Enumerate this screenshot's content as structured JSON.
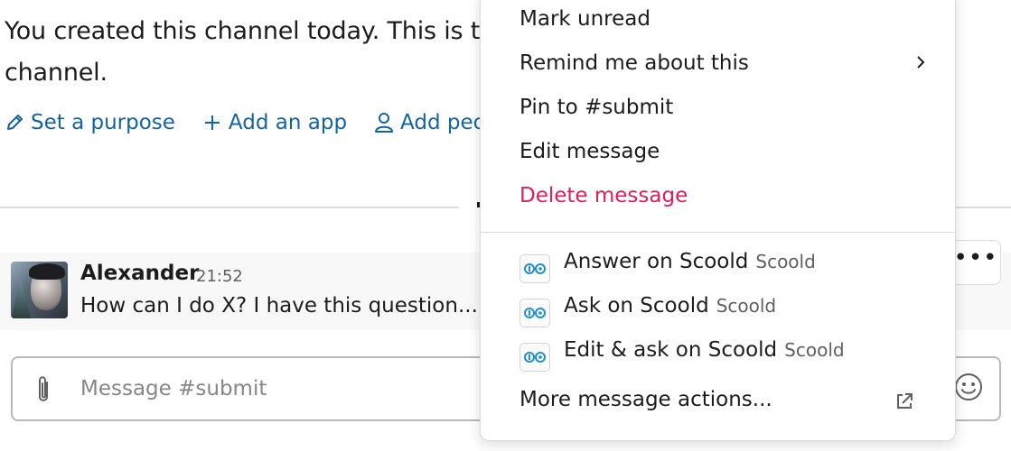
{
  "channel_intro": {
    "text": "You created this channel today. This is t channel.",
    "line1": "You created this channel today. This is t",
    "line2": "channel.",
    "actions": [
      {
        "icon": "pencil-icon",
        "label": "Set a purpose"
      },
      {
        "icon": "plus-icon",
        "label": "Add an app"
      },
      {
        "icon": "person-icon",
        "label": "Add peop"
      }
    ]
  },
  "message": {
    "author": "Alexander",
    "time": "21:52",
    "text": "How can I do X? I have this question..."
  },
  "message_actions": {
    "more_label": "•••"
  },
  "composer": {
    "placeholder": "Message #submit",
    "attach_icon": "paperclip-icon",
    "emoji_icon": "emoji-icon"
  },
  "context_menu": {
    "items": [
      {
        "label": "Mark unread"
      },
      {
        "label": "Remind me about this",
        "has_submenu": true
      },
      {
        "label": "Pin to #submit"
      },
      {
        "label": "Edit message"
      },
      {
        "label": "Delete message",
        "danger": true
      }
    ],
    "app_actions": [
      {
        "label": "Answer on Scoold",
        "app": "Scoold"
      },
      {
        "label": "Ask on Scoold",
        "app": "Scoold"
      },
      {
        "label": "Edit & ask on Scoold",
        "app": "Scoold"
      }
    ],
    "more_actions": {
      "label": "More message actions...",
      "icon": "external-link-icon"
    }
  },
  "colors": {
    "link": "#1264a3",
    "danger": "#e01e5a",
    "text": "#1d1c1d",
    "muted": "#616061",
    "app_icon": "#1e8fd0"
  }
}
